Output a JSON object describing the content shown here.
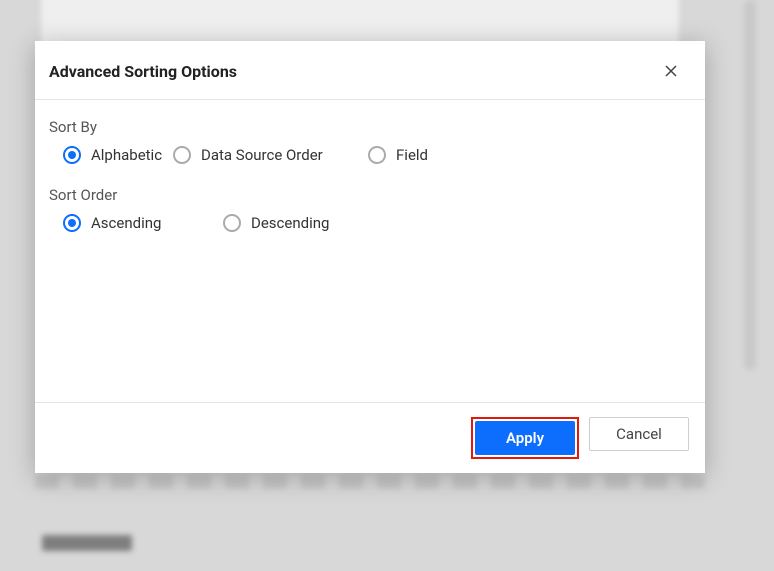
{
  "modal": {
    "title": "Advanced Sorting Options",
    "sort_by": {
      "label": "Sort By",
      "options": {
        "alphabetic": "Alphabetic",
        "data_source_order": "Data Source Order",
        "field": "Field"
      },
      "selected": "alphabetic"
    },
    "sort_order": {
      "label": "Sort Order",
      "options": {
        "ascending": "Ascending",
        "descending": "Descending"
      },
      "selected": "ascending"
    },
    "footer": {
      "apply": "Apply",
      "cancel": "Cancel"
    }
  }
}
